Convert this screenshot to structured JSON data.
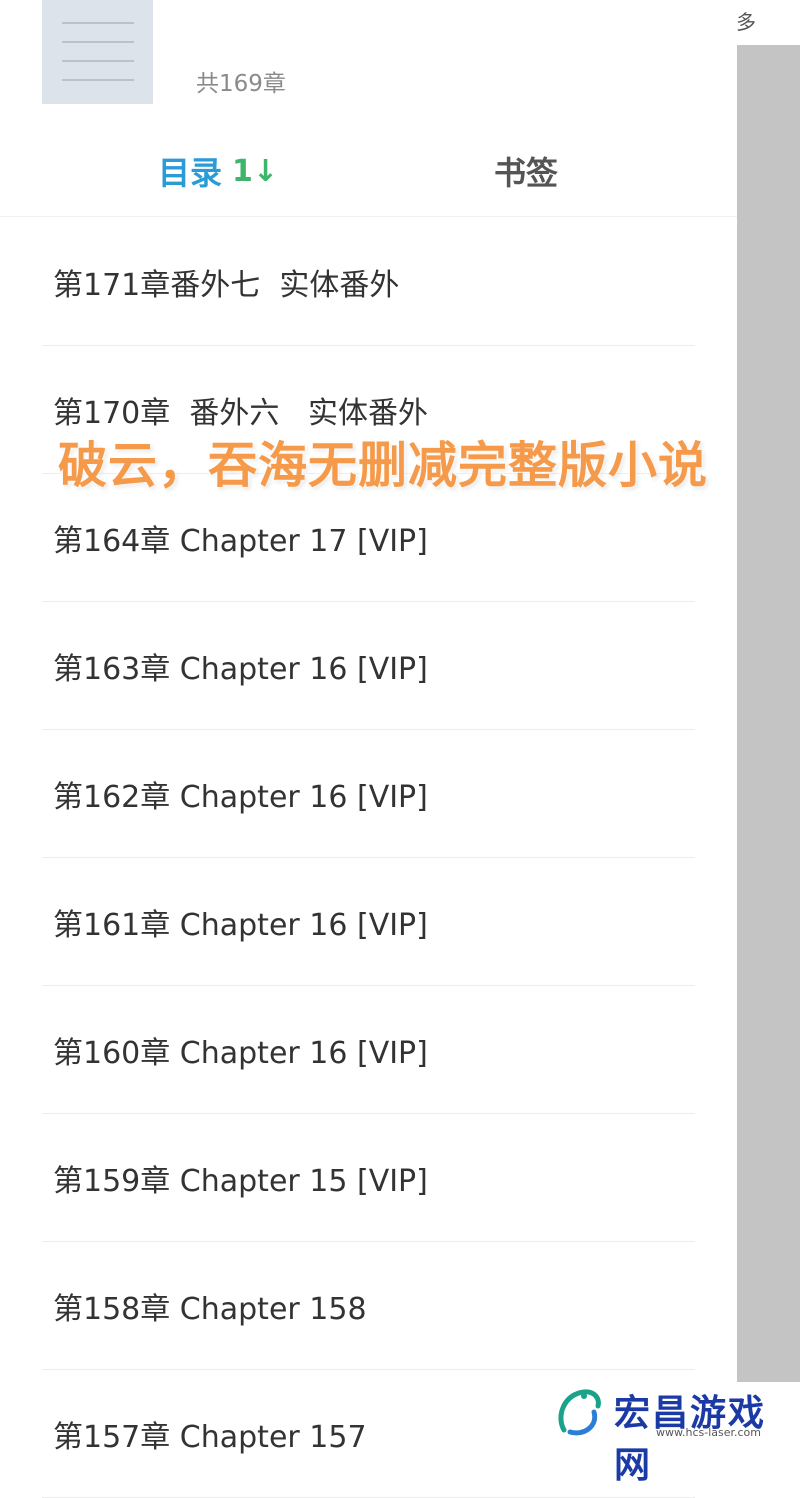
{
  "background": {
    "more_label": "多"
  },
  "header": {
    "chapter_count": "共169章"
  },
  "tabs": [
    {
      "label": "目录",
      "sort_glyph": "1↓"
    },
    {
      "label": "书签"
    }
  ],
  "chapters": [
    "第171章番外七  实体番外",
    "第170章  番外六   实体番外",
    "第164章 Chapter 17 [VIP]",
    "第163章 Chapter 16 [VIP]",
    "第162章 Chapter 16 [VIP]",
    "第161章 Chapter 16 [VIP]",
    "第160章 Chapter 16 [VIP]",
    "第159章 Chapter 15 [VIP]",
    "第158章 Chapter 158",
    "第157章 Chapter 157"
  ],
  "overlay": {
    "title": "破云，吞海无删减完整版小说"
  },
  "watermark": {
    "brand": "宏昌游戏网",
    "url": "www.hcs-laser.com"
  }
}
